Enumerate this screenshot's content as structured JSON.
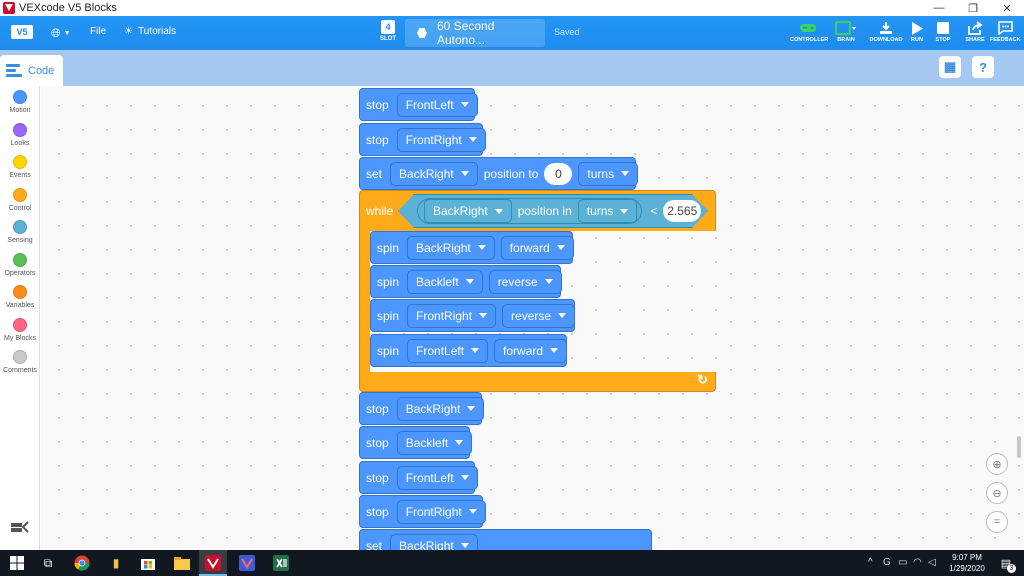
{
  "window": {
    "title": "VEXcode V5 Blocks",
    "controls": [
      "—",
      "❐",
      "✕"
    ]
  },
  "header": {
    "logo": "V5",
    "menus": {
      "file": "File",
      "tutorials": "Tutorials"
    },
    "slot": {
      "number": "4",
      "label": "SLOT"
    },
    "project_name": "60 Second Autono...",
    "status": "Saved",
    "tools": [
      {
        "label": "CONTROLLER",
        "icon": "controller-icon"
      },
      {
        "label": "BRAIN",
        "icon": "brain-icon"
      },
      {
        "label": "DOWNLOAD",
        "icon": "download-icon"
      },
      {
        "label": "RUN",
        "icon": "run-icon"
      },
      {
        "label": "STOP",
        "icon": "stop-icon"
      },
      {
        "label": "SHARE",
        "icon": "share-icon"
      },
      {
        "label": "FEEDBACK",
        "icon": "feedback-icon"
      }
    ],
    "accent": "#1e8ff0",
    "status_green": "#3cd35c"
  },
  "tabs": {
    "code": "Code"
  },
  "categories": [
    {
      "label": "Motion",
      "color": "#4c97ff"
    },
    {
      "label": "Looks",
      "color": "#9966ff"
    },
    {
      "label": "Events",
      "color": "#ffd500"
    },
    {
      "label": "Control",
      "color": "#ffab19"
    },
    {
      "label": "Sensing",
      "color": "#5cb1d6"
    },
    {
      "label": "Operators",
      "color": "#59c059"
    },
    {
      "label": "Variables",
      "color": "#ff8c1a"
    },
    {
      "label": "My Blocks",
      "color": "#ff6680"
    },
    {
      "label": "Comments",
      "color": "#c8c8c8"
    }
  ],
  "blocks": {
    "top": [
      {
        "kw": "stop",
        "motor": "FrontLeft"
      },
      {
        "kw": "stop",
        "motor": "FrontRight"
      }
    ],
    "set": {
      "kw": "set",
      "motor": "BackRight",
      "text1": "position to",
      "value": "0",
      "unit": "turns"
    },
    "while": {
      "kw": "while",
      "motor": "BackRight",
      "text": "position in",
      "unit": "turns",
      "op": "<",
      "value": "2.565"
    },
    "spins": [
      {
        "kw": "spin",
        "motor": "BackRight",
        "dir": "forward"
      },
      {
        "kw": "spin",
        "motor": "Backleft",
        "dir": "reverse"
      },
      {
        "kw": "spin",
        "motor": "FrontRight",
        "dir": "reverse"
      },
      {
        "kw": "spin",
        "motor": "FrontLeft",
        "dir": "forward"
      }
    ],
    "bottom": [
      {
        "kw": "stop",
        "motor": "BackRight"
      },
      {
        "kw": "stop",
        "motor": "Backleft"
      },
      {
        "kw": "stop",
        "motor": "FrontLeft"
      },
      {
        "kw": "stop",
        "motor": "FrontRight"
      }
    ],
    "partial_set": {
      "kw": "set",
      "motor": "BackRight"
    }
  },
  "taskbar": {
    "time": "9:07 PM",
    "date": "1/29/2020",
    "notifications": "3"
  }
}
